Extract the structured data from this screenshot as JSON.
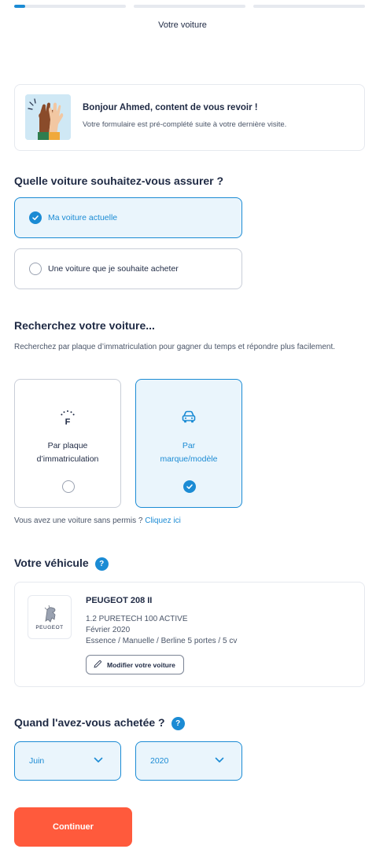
{
  "progress": {
    "segments": [
      {
        "fill": 0.1
      },
      {
        "fill": 0
      },
      {
        "fill": 0
      }
    ]
  },
  "header": {
    "step_title": "Votre voiture"
  },
  "welcome": {
    "title": "Bonjour Ahmed, content de vous revoir !",
    "subtitle": "Votre formulaire est pré-complété suite à votre dernière visite.",
    "illustration": "high-five-illustration"
  },
  "car_type": {
    "question": "Quelle voiture souhaitez-vous assurer ?",
    "options": [
      {
        "label": "Ma voiture actuelle",
        "selected": true
      },
      {
        "label": "Une voiture que je souhaite acheter",
        "selected": false
      }
    ]
  },
  "search": {
    "title": "Recherchez votre voiture...",
    "description": "Recherchez par plaque d’immatriculation pour gagner du temps et répondre plus facilement.",
    "options": [
      {
        "line1": "Par plaque",
        "line2": "d’immatriculation",
        "icon": "license-plate-icon",
        "selected": false
      },
      {
        "line1": "Par",
        "line2": "marque/modèle",
        "icon": "car-icon",
        "selected": true
      }
    ],
    "sans_permis_text": "Vous avez une voiture sans permis ?",
    "sans_permis_link": "Cliquez ici"
  },
  "vehicle": {
    "title": "Votre véhicule",
    "help_glyph": "?",
    "brand_logo_text": "PEUGEOT",
    "name": "PEUGEOT 208 II",
    "version": "1.2 PURETECH 100 ACTIVE",
    "date": "Février 2020",
    "specs": "Essence / Manuelle / Berline 5 portes / 5 cv",
    "modify_label": "Modifier votre voiture"
  },
  "purchase": {
    "title": "Quand l'avez-vous achetée ?",
    "help_glyph": "?",
    "month": "Juin",
    "year": "2020"
  },
  "actions": {
    "continue_label": "Continuer"
  },
  "colors": {
    "accent": "#1b8bd4",
    "accent_bg": "#eaf5fc",
    "cta": "#ff5a3c",
    "text": "#1f2a44"
  }
}
